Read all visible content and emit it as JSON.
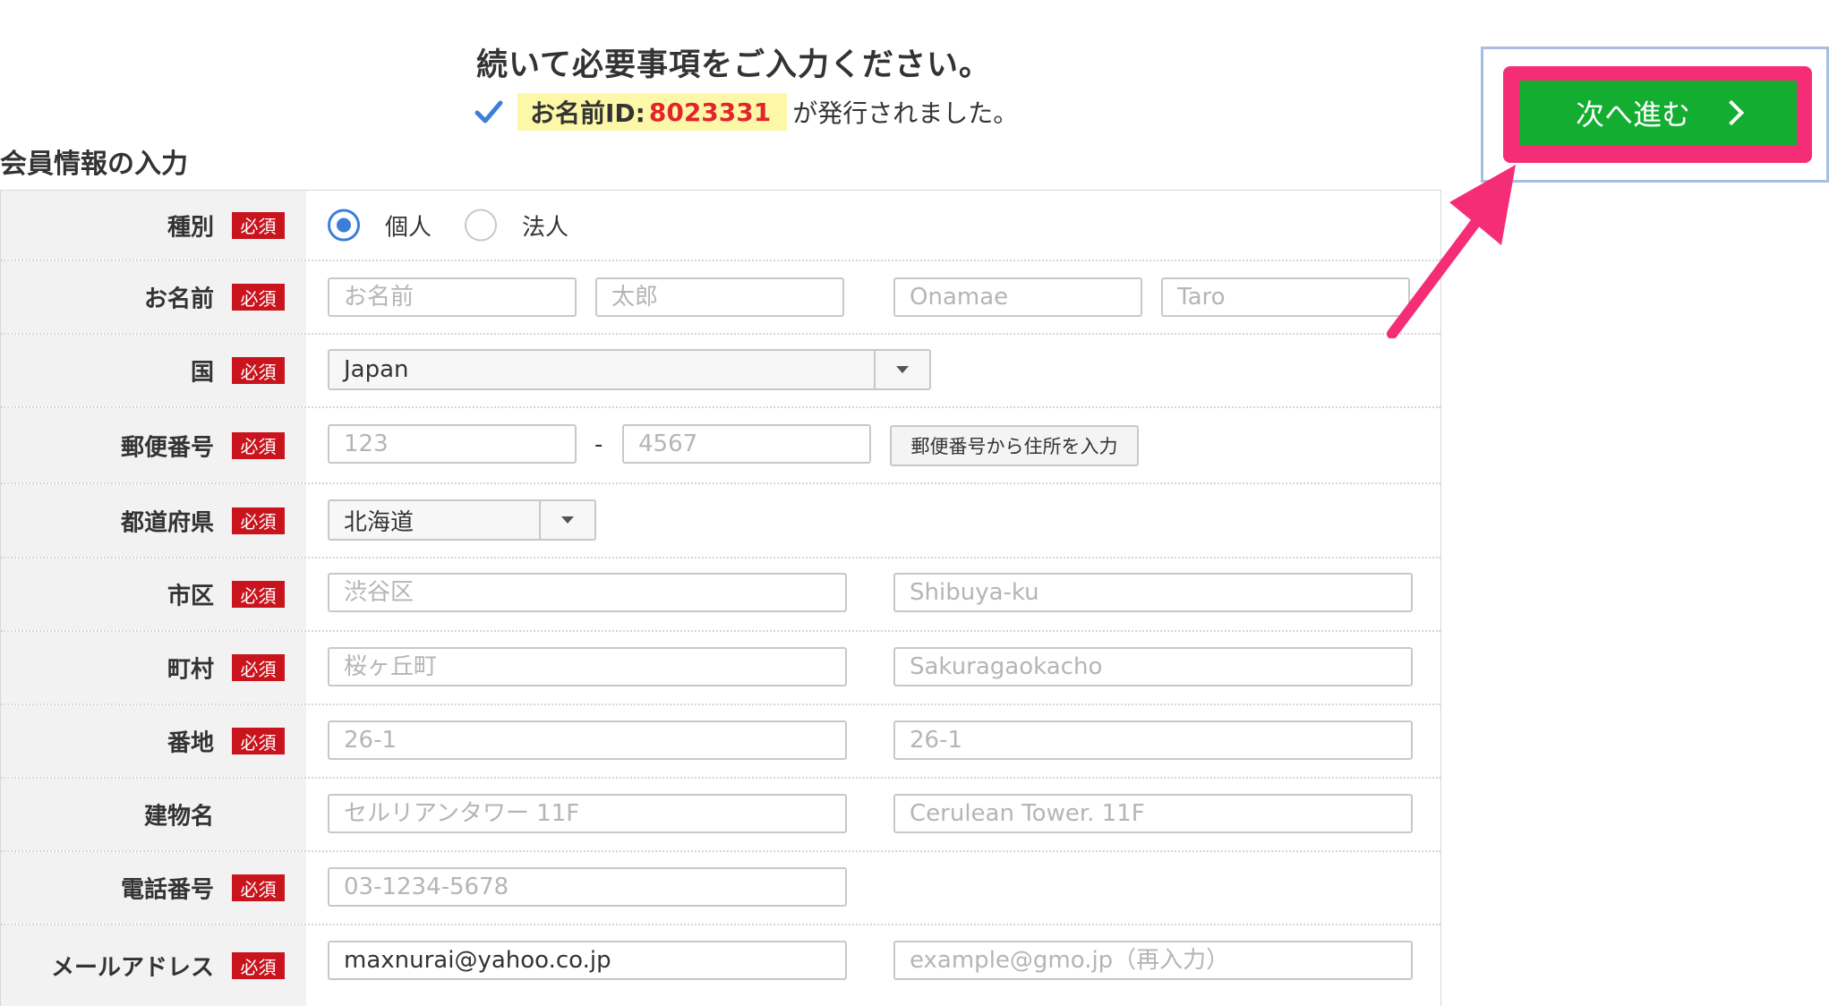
{
  "header": {
    "title": "続いて必要事項をご入力ください。",
    "id_label": "お名前ID:",
    "id_number": "8023331",
    "id_suffix": "が発行されました。"
  },
  "section_title": "会員情報の入力",
  "required_badge": "必須",
  "next_button": {
    "label": "次へ進む"
  },
  "form": {
    "type": {
      "label": "種別",
      "options": [
        "個人",
        "法人"
      ],
      "selected": "個人"
    },
    "name": {
      "label": "お名前",
      "placeholders": [
        "お名前",
        "太郎",
        "Onamae",
        "Taro"
      ]
    },
    "country": {
      "label": "国",
      "value": "Japan"
    },
    "postal": {
      "label": "郵便番号",
      "placeholder_1": "123",
      "separator": "-",
      "placeholder_2": "4567",
      "lookup_button": "郵便番号から住所を入力"
    },
    "prefecture": {
      "label": "都道府県",
      "value": "北海道"
    },
    "city": {
      "label": "市区",
      "placeholder_ja": "渋谷区",
      "placeholder_en": "Shibuya-ku"
    },
    "town": {
      "label": "町村",
      "placeholder_ja": "桜ヶ丘町",
      "placeholder_en": "Sakuragaokacho"
    },
    "address": {
      "label": "番地",
      "placeholder_ja": "26-1",
      "placeholder_en": "26-1"
    },
    "building": {
      "label": "建物名",
      "placeholder_ja": "セルリアンタワー 11F",
      "placeholder_en": "Cerulean Tower. 11F"
    },
    "phone": {
      "label": "電話番号",
      "placeholder": "03-1234-5678"
    },
    "email": {
      "label": "メールアドレス",
      "value": "maxnurai@yahoo.co.jp",
      "confirm_placeholder": "example@gmo.jp（再入力）"
    }
  },
  "colors": {
    "required": "#c9141d",
    "next_button": "#13ad31",
    "highlight": "#f52d76",
    "id_number": "#e2242c",
    "radio_selected": "#3b7fd9"
  }
}
